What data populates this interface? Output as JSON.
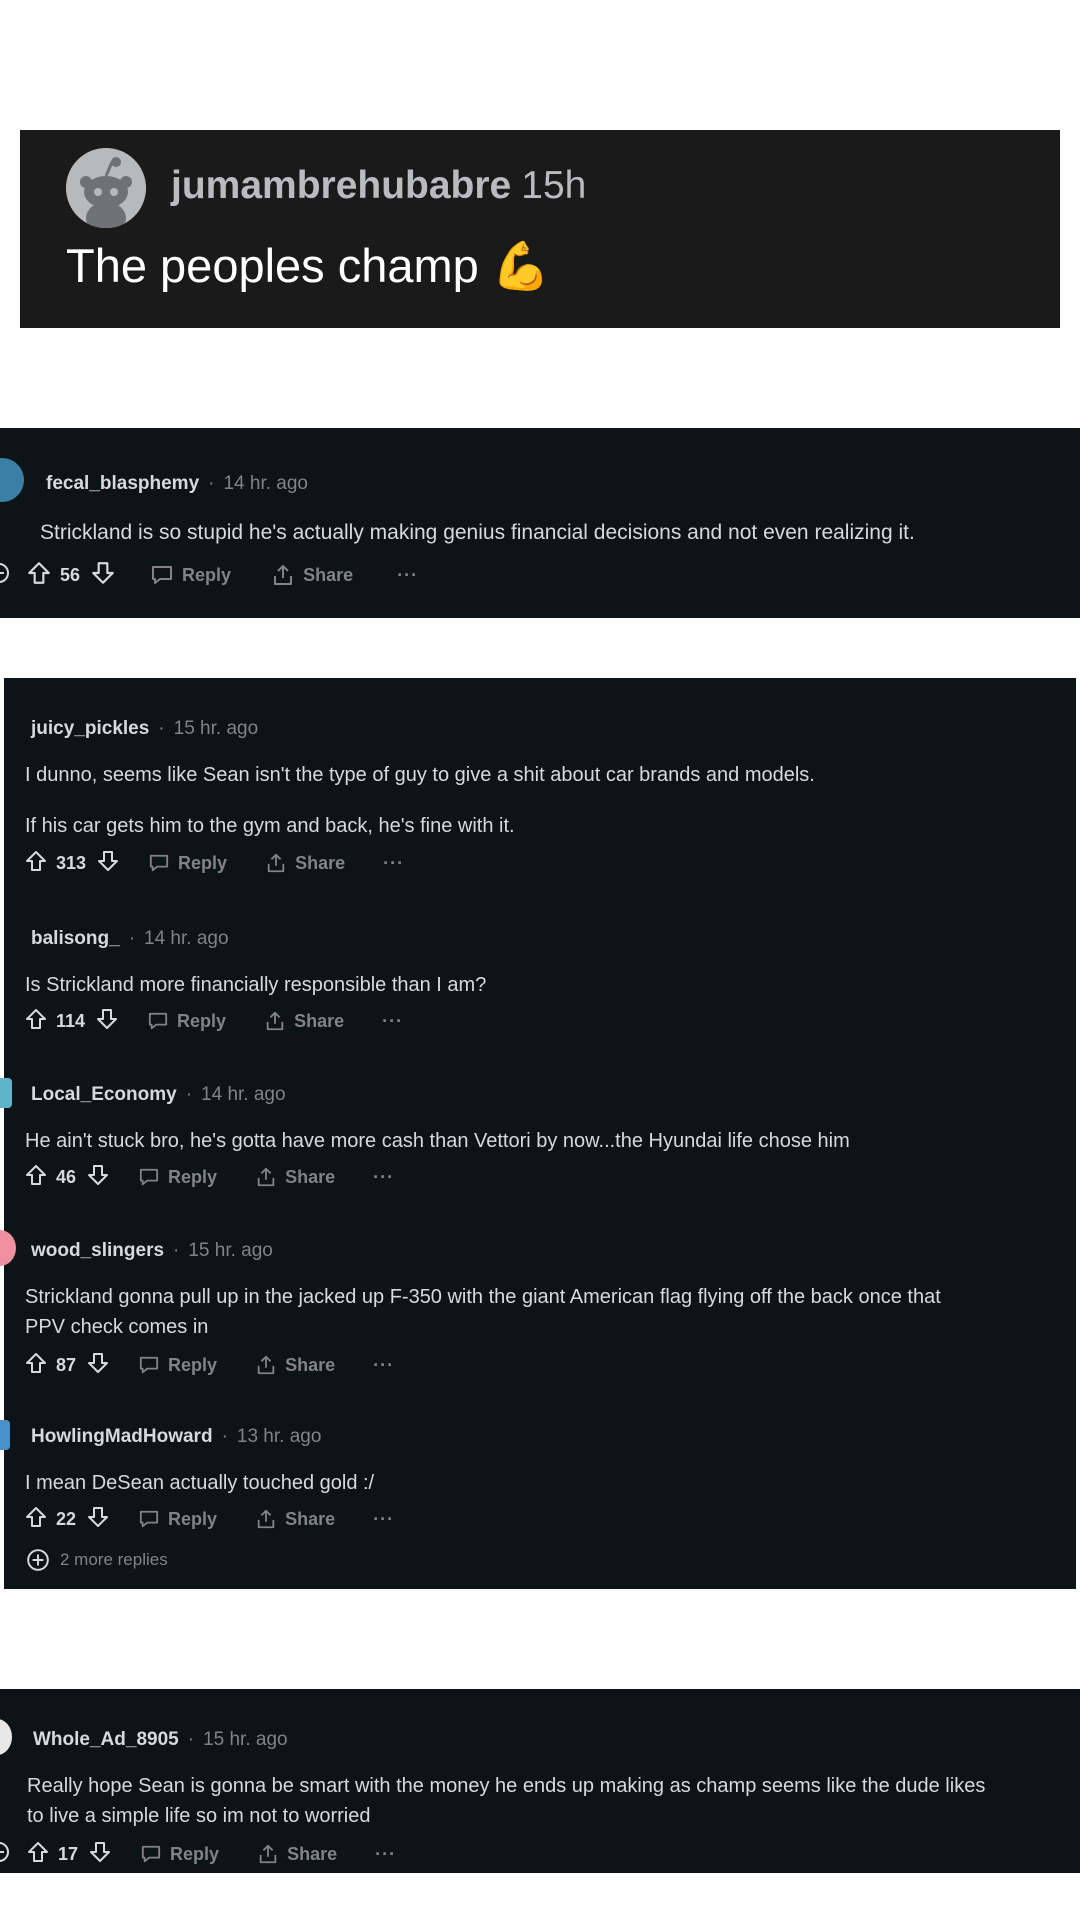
{
  "post": {
    "username": "jumambrehubabre",
    "time": "15h",
    "text": "The peoples champ",
    "emoji": "💪"
  },
  "comments_top": [
    {
      "username": "fecal_blasphemy",
      "time": "14 hr. ago",
      "lines": [
        "Strickland is so stupid he's actually making genius financial decisions and not even realizing it."
      ],
      "score": "56",
      "reply": "Reply",
      "share": "Share"
    }
  ],
  "comments_thread": [
    {
      "username": "juicy_pickles",
      "time": "15 hr. ago",
      "lines": [
        "I dunno, seems like Sean isn't the type of guy to give a shit about car brands and models.",
        "If his car gets him to the gym and back, he's fine with it."
      ],
      "score": "313",
      "reply": "Reply",
      "share": "Share"
    },
    {
      "username": "balisong_",
      "time": "14 hr. ago",
      "lines": [
        "Is Strickland more financially responsible than I am?"
      ],
      "score": "114",
      "reply": "Reply",
      "share": "Share"
    },
    {
      "username": "Local_Economy",
      "time": "14 hr. ago",
      "lines": [
        "He ain't stuck bro, he's gotta have more cash than Vettori by now...the Hyundai life chose him"
      ],
      "score": "46",
      "reply": "Reply",
      "share": "Share"
    },
    {
      "username": "wood_slingers",
      "time": "15 hr. ago",
      "lines": [
        "Strickland gonna pull up in the jacked up F-350 with the giant American flag flying off the back once that",
        "PPV check comes in"
      ],
      "score": "87",
      "reply": "Reply",
      "share": "Share"
    },
    {
      "username": "HowlingMadHoward",
      "time": "13 hr. ago",
      "lines": [
        "I mean DeSean actually touched gold :/"
      ],
      "score": "22",
      "reply": "Reply",
      "share": "Share"
    }
  ],
  "more_replies": "2 more replies",
  "comments_bottom": [
    {
      "username": "Whole_Ad_8905",
      "time": "15 hr. ago",
      "lines": [
        "Really hope Sean is gonna be smart with the money he ends up making as champ seems like the dude likes",
        "to live a simple life so im not to worried"
      ],
      "score": "17",
      "reply": "Reply",
      "share": "Share"
    }
  ],
  "more_glyph": "···",
  "dot_glyph": "·",
  "colors": {
    "panel": "#0d1417",
    "post_card": "#1a1a1b",
    "text": "#d7dadc",
    "muted": "#818384",
    "emoji": "#f5b521"
  }
}
